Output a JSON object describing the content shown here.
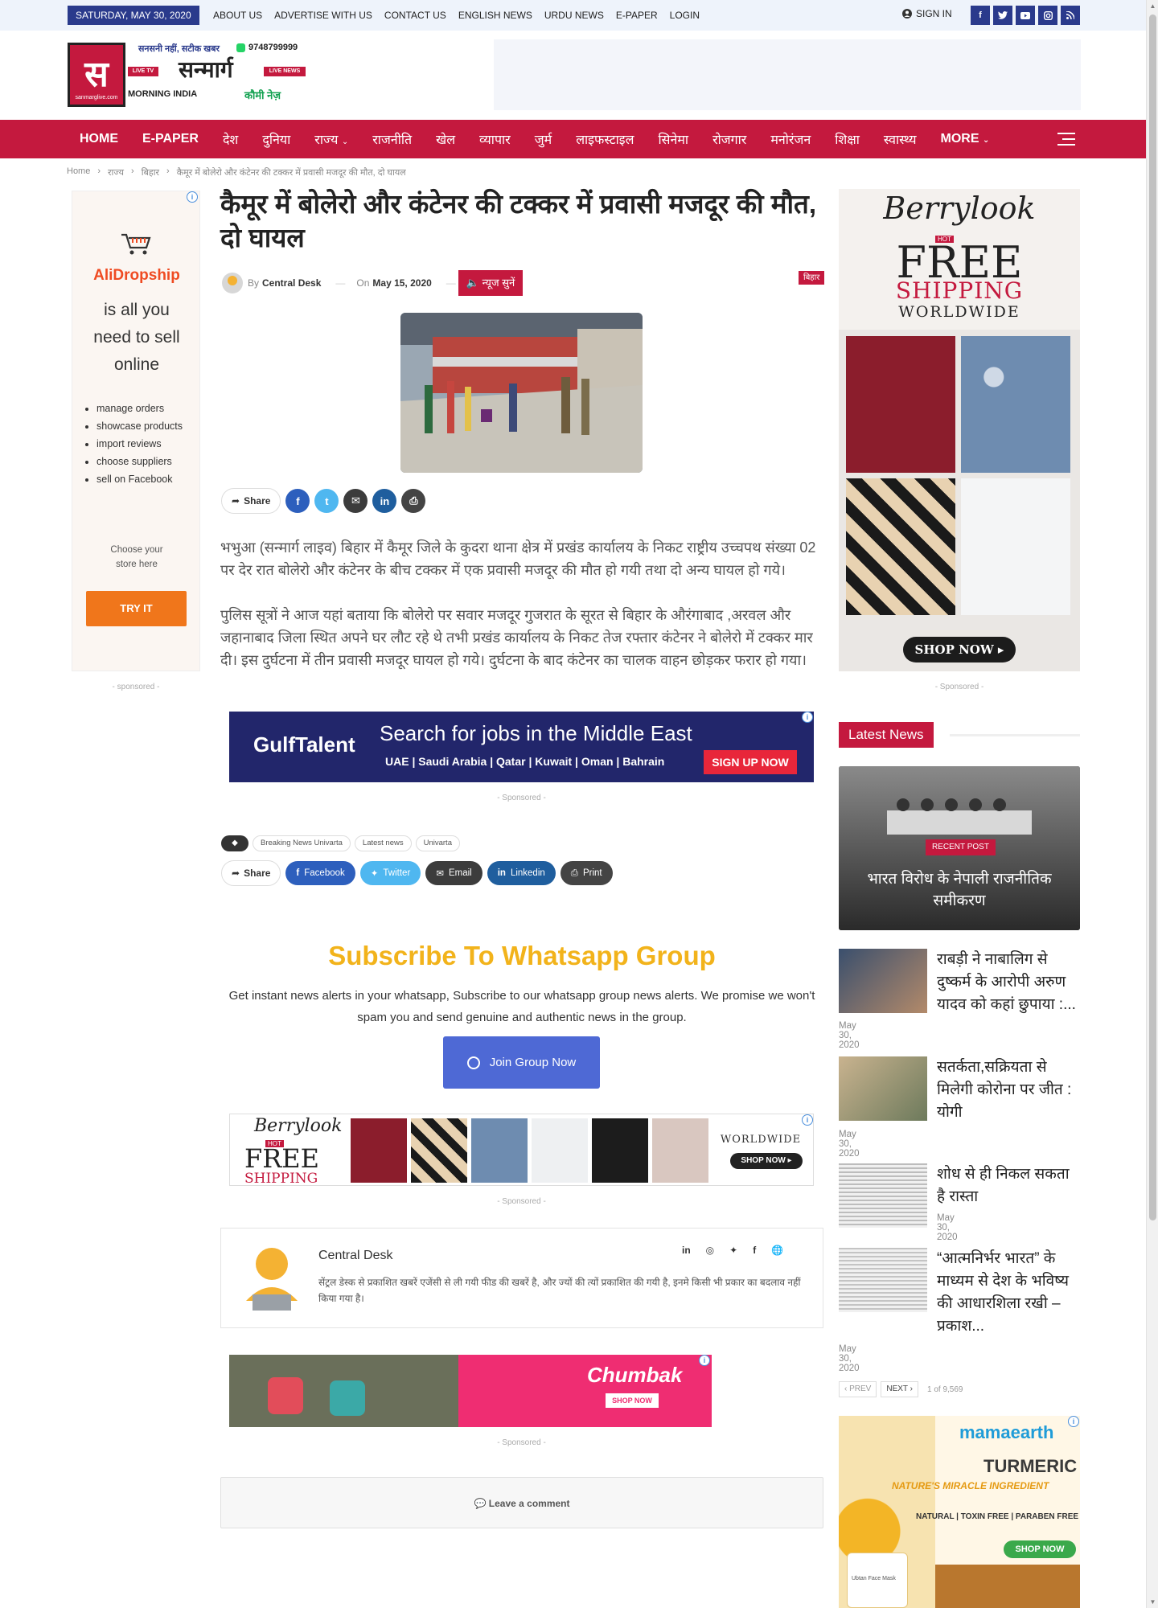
{
  "topbar": {
    "date": "SATURDAY, MAY 30, 2020",
    "links": [
      "ABOUT US",
      "ADVERTISE WITH US",
      "CONTACT US",
      "ENGLISH NEWS",
      "URDU NEWS",
      "E-PAPER",
      "LOGIN"
    ],
    "signin": "SIGN IN",
    "social": [
      "facebook-icon",
      "twitter-icon",
      "youtube-icon",
      "instagram-icon",
      "rss-icon"
    ]
  },
  "logo": {
    "tagline": "सनसनी नहीं, सटीक खबर",
    "phone": "9748799999",
    "brand": "सन्मार्ग",
    "live_tv": "LIVE TV",
    "live_news": "LIVE NEWS",
    "morning": "MORNING INDIA",
    "urdu": "कौमी नेज़",
    "url": "sanmarglive.com",
    "mark": "स"
  },
  "nav": {
    "items": [
      "HOME",
      "E-PAPER",
      "देश",
      "दुनिया",
      "राज्य",
      "राजनीति",
      "खेल",
      "व्यापार",
      "जुर्म",
      "लाइफस्टाइल",
      "सिनेमा",
      "रोजगार",
      "मनोरंजन",
      "शिक्षा",
      "स्वास्थ्य",
      "MORE"
    ]
  },
  "breadcrumb": [
    "Home",
    "राज्य",
    "बिहार",
    "कैमूर में बोलेरो और कंटेनर की टक्कर में प्रवासी मजदूर की मौत, दो घायल"
  ],
  "article": {
    "title": "कैमूर में बोलेरो और कंटेनर की टक्कर में प्रवासी मजदूर की मौत, दो घायल",
    "by": "By",
    "author": "Central Desk",
    "on": "On",
    "date": "May 15, 2020",
    "listen": "न्यूज सुनें",
    "category": "बिहार",
    "share": "Share",
    "p1": "भभुआ (सन्मार्ग लाइव) बिहार में कैमूर जिले के कुदरा थाना क्षेत्र में प्रखंड कार्यालय के निकट राष्ट्रीय उच्चपथ संख्या 02 पर देर रात बोलेरो और कंटेनर के बीच टक्कर में एक प्रवासी मजदूर की मौत हो गयी तथा दो अन्य घायल हो गये।",
    "p2": "पुलिस सूत्रों ने आज यहां बताया कि बोलेरो पर सवार मजदूर गुजरात के सूरत से बिहार के औरंगाबाद ,अरवल और जहानाबाद जिला स्थित अपने घर लौट रहे थे तभी प्रखंड कार्यालय के निकट तेज रफ्तार कंटेनर ने बोलेरो में टक्कर मार दी। इस दुर्घटना में तीन प्रवासी मजदूर घायल हो गये। दुर्घटना के बाद कंटेनर का चालक वाहन छोड़कर फरार हो गया।",
    "tags": [
      "Breaking News Univarta",
      "Latest news",
      "Univarta"
    ],
    "share_buttons": [
      "Facebook",
      "Twitter",
      "Email",
      "Linkedin",
      "Print"
    ]
  },
  "ads": {
    "sponsored": "- Sponsored -",
    "sponsored_lower": "- sponsored -",
    "ali_brand": "AliDropship",
    "ali_tag": [
      "is all you",
      "need to sell",
      "online"
    ],
    "ali_list": [
      "manage orders",
      "showcase products",
      "import reviews",
      "choose suppliers",
      "sell on Facebook"
    ],
    "ali_store": [
      "Choose your",
      "store here"
    ],
    "ali_btn": "TRY IT",
    "gulf_brand": "GulfTalent",
    "gulf_head": "Search for jobs in the Middle East",
    "gulf_sub": "UAE | Saudi Arabia | Qatar | Kuwait | Oman | Bahrain",
    "gulf_btn": "SIGN UP NOW",
    "berry_brand": "Berrylook",
    "berry_hot": "HOT",
    "berry_free": "FREE",
    "berry_ship": "SHIPPING",
    "berry_world": "WORLDWIDE",
    "berry_btn": "SHOP NOW ▸",
    "chumbak": "Chumbak",
    "chumbak_btn": "SHOP NOW",
    "mama_brand": "mamaearth",
    "mama_title": "TURMERIC",
    "mama_sub": "NATURE'S MIRACLE INGREDIENT",
    "mama_free": "NATURAL | TOXIN FREE | PARABEN FREE",
    "mama_btn": "SHOP NOW",
    "mama_label": "Ubtan Face Mask"
  },
  "subscribe": {
    "title": "Subscribe To Whatsapp Group",
    "text": "Get instant news alerts in your whatsapp, Subscribe to our whatsapp group news alerts. We promise we won't spam you and send genuine and authentic news in the group.",
    "button": "Join Group Now"
  },
  "author_box": {
    "name": "Central Desk",
    "desc": "सेंट्रल डेस्क से प्रकाशित खबरें एजेंसी से ली गयी फीड की खबरें है, और ज्यों की त्यों प्रकाशित की गयी है, इनमे किसी भी प्रकार का बदलाव नहीं किया गया है।"
  },
  "comment": "Leave a comment",
  "sidebar": {
    "latest": "Latest News",
    "featured_badge": "RECENT POST",
    "featured_title": "भारत विरोध के नेपाली राजनीतिक समीकरण",
    "items": [
      {
        "title": "राबड़ी ने नाबालिग से दुष्कर्म के आरोपी अरुण यादव को कहां छुपाया :...",
        "date": "May 30, 2020"
      },
      {
        "title": "सतर्कता,सक्रियता से मिलेगी कोरोना पर जीत : योगी",
        "date": "May 30, 2020"
      },
      {
        "title": "शोध से ही निकल सकता है रास्ता",
        "date": "May 30, 2020"
      },
      {
        "title": "“आत्मनिर्भर भारत” के माध्यम से देश के भविष्य की आधारशिला रखी – प्रकाश...",
        "date": "May 30, 2020"
      }
    ],
    "prev": "PREV",
    "next": "NEXT",
    "page_info": "1 of 9,569"
  },
  "colors": {
    "brand": "#c4193e",
    "navy": "#2a3a8c",
    "accent_yellow": "#f2b31b"
  }
}
